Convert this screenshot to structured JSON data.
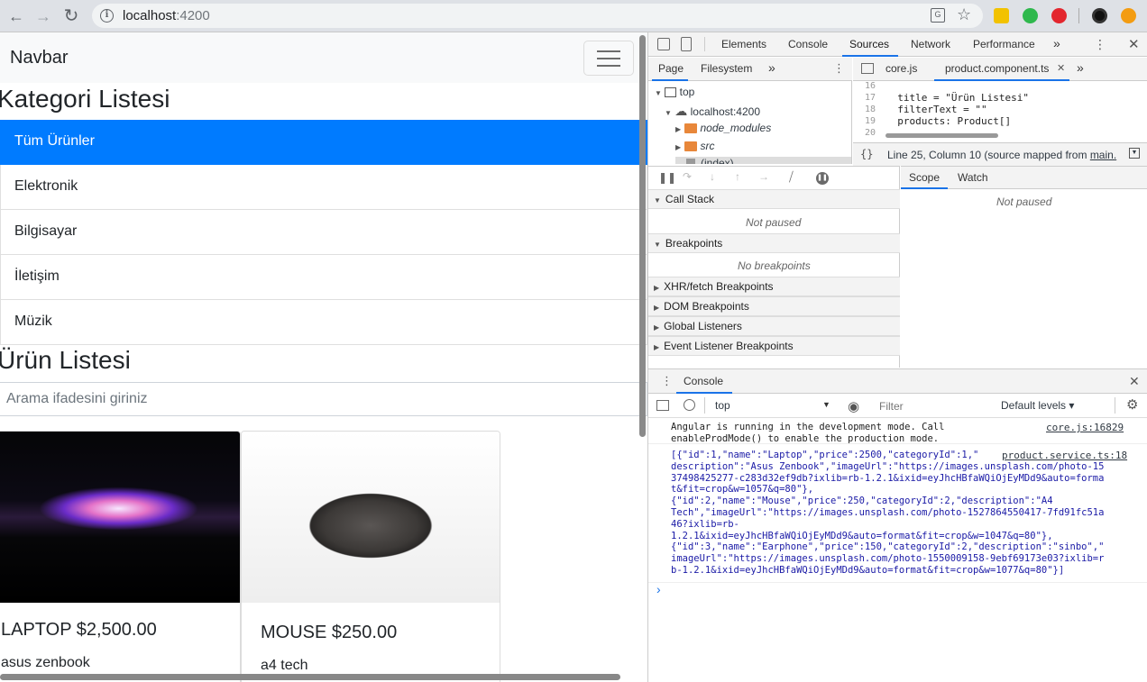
{
  "browser": {
    "url_host": "localhost",
    "url_port": ":4200",
    "back": "←",
    "forward": "→",
    "reload": "↻",
    "star": "☆"
  },
  "app": {
    "brand": "Navbar",
    "category_heading": "Kategori Listesi",
    "categories": [
      "Tüm Ürünler",
      "Elektronik",
      "Bilgisayar",
      "İletişim",
      "Müzik"
    ],
    "product_heading": "Ürün Listesi",
    "search_placeholder": "Arama ifadesini giriniz",
    "products": [
      {
        "title": "LAPTOP $2,500.00",
        "description": "asus zenbook"
      },
      {
        "title": "MOUSE $250.00",
        "description": "a4 tech"
      }
    ]
  },
  "devtools": {
    "tabs": [
      "Elements",
      "Console",
      "Sources",
      "Network",
      "Performance"
    ],
    "more": "»",
    "nav_tabs": [
      "Page",
      "Filesystem"
    ],
    "tree": {
      "top": "top",
      "host": "localhost:4200",
      "node_modules": "node_modules",
      "src": "src",
      "index": "(index)"
    },
    "editor_tabs": [
      "core.js",
      "product.component.ts"
    ],
    "code_lines": [
      {
        "n": "16",
        "text": ""
      },
      {
        "n": "17",
        "text": "  title = \"Ürün Listesi\""
      },
      {
        "n": "18",
        "text": "  filterText = \"\""
      },
      {
        "n": "19",
        "text": "  products: Product[]"
      },
      {
        "n": "20",
        "text": ""
      }
    ],
    "status_pos": "Line 25, Column 10",
    "status_mapped": "(source mapped from",
    "status_link": "main.",
    "scope_tabs": [
      "Scope",
      "Watch"
    ],
    "scope_empty": "Not paused",
    "sections": [
      "Call Stack",
      "Breakpoints",
      "XHR/fetch Breakpoints",
      "DOM Breakpoints",
      "Global Listeners",
      "Event Listener Breakpoints"
    ],
    "callstack_empty": "Not paused",
    "breakpoints_empty": "No breakpoints",
    "drawer_tab": "Console",
    "context": "top",
    "filter_placeholder": "Filter",
    "levels": "Default levels ▾",
    "messages": [
      {
        "text": "Angular is running in the development mode. Call\nenableProdMode() to enable the production mode.",
        "source": "core.js:16829"
      },
      {
        "text": "[{\"id\":1,\"name\":\"Laptop\",\"price\":2500,\"categoryId\":1,\"\ndescription\":\"Asus Zenbook\",\"imageUrl\":\"https://images.unsplash.com/photo-15\n37498425277-c283d32ef9db?ixlib=rb-1.2.1&ixid=eyJhcHBfaWQiOjEyMDd9&auto=forma\nt&fit=crop&w=1057&q=80\"},\n{\"id\":2,\"name\":\"Mouse\",\"price\":250,\"categoryId\":2,\"description\":\"A4\nTech\",\"imageUrl\":\"https://images.unsplash.com/photo-1527864550417-7fd91fc51a\n46?ixlib=rb-\n1.2.1&ixid=eyJhcHBfaWQiOjEyMDd9&auto=format&fit=crop&w=1047&q=80\"},\n{\"id\":3,\"name\":\"Earphone\",\"price\":150,\"categoryId\":2,\"description\":\"sinbo\",\"\nimageUrl\":\"https://images.unsplash.com/photo-1550009158-9ebf69173e03?ixlib=r\nb-1.2.1&ixid=eyJhcHBfaWQiOjEyMDd9&auto=format&fit=crop&w=1077&q=80\"}]",
        "source": "product.service.ts:18"
      }
    ],
    "prompt": "›"
  }
}
